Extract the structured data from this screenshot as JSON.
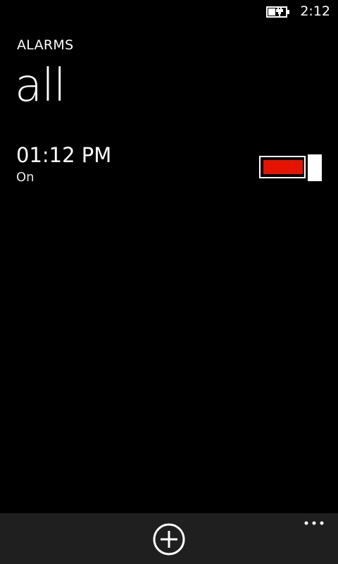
{
  "status_bar": {
    "time": "2:12",
    "battery_icon": "battery-charging-icon"
  },
  "header": {
    "app_title": "ALARMS",
    "page_title": "all"
  },
  "alarms": [
    {
      "time": "01:12 PM",
      "status": "On",
      "enabled": true
    }
  ],
  "colors": {
    "background": "#000000",
    "accent": "#e51400",
    "app_bar": "#1f1f1f",
    "text": "#ffffff"
  },
  "app_bar": {
    "add_icon": "add-icon",
    "more_icon": "more-icon"
  }
}
